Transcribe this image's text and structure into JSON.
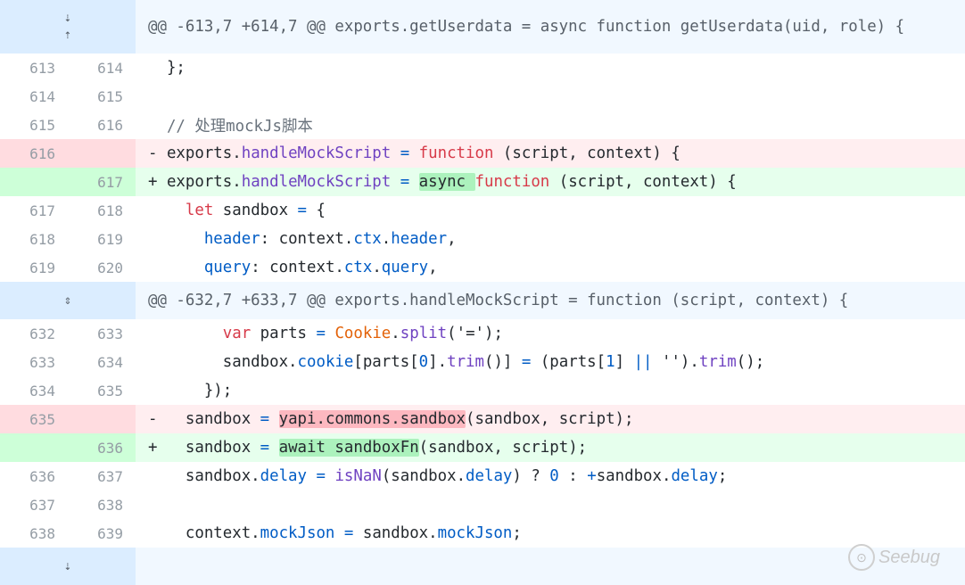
{
  "hunks": {
    "h1": "@@ -613,7 +614,7 @@ exports.getUserdata = async function getUserdata(uid, role) {",
    "h2": "@@ -632,7 +633,7 @@ exports.handleMockScript = function (script, context) {"
  },
  "lines": {
    "l1": {
      "old": "613",
      "new": "614"
    },
    "l2": {
      "old": "614",
      "new": "615"
    },
    "l3": {
      "old": "615",
      "new": "616"
    },
    "l4": {
      "old": "616",
      "new": ""
    },
    "l5": {
      "old": "",
      "new": "617"
    },
    "l6": {
      "old": "617",
      "new": "618"
    },
    "l7": {
      "old": "618",
      "new": "619"
    },
    "l8": {
      "old": "619",
      "new": "620"
    },
    "l9": {
      "old": "632",
      "new": "633"
    },
    "l10": {
      "old": "633",
      "new": "634"
    },
    "l11": {
      "old": "634",
      "new": "635"
    },
    "l12": {
      "old": "635",
      "new": ""
    },
    "l13": {
      "old": "",
      "new": "636"
    },
    "l14": {
      "old": "636",
      "new": "637"
    },
    "l15": {
      "old": "637",
      "new": "638"
    },
    "l16": {
      "old": "638",
      "new": "639"
    }
  },
  "code": {
    "l1": "  };",
    "l3": "  // 处理mockJs脚本",
    "l4_sign": "- ",
    "l4_obj": "exports.",
    "l4_prop": "handleMockScript",
    "l4_eq": " = ",
    "l4_kw": "function",
    "l4_rest": " (script, context) {",
    "l5_sign": "+ ",
    "l5_obj": "exports.",
    "l5_prop": "handleMockScript",
    "l5_eq": " = ",
    "l5_async": "async ",
    "l5_kw": "function",
    "l5_rest": " (script, context) {",
    "l6_indent": "    ",
    "l6_kw": "let",
    "l6_var": " sandbox ",
    "l6_eq": "=",
    "l6_rest": " {",
    "l7_indent": "      ",
    "l7_key": "header",
    "l7_mid": ": context.",
    "l7_p1": "ctx",
    "l7_dot": ".",
    "l7_p2": "header",
    "l7_end": ",",
    "l8_indent": "      ",
    "l8_key": "query",
    "l8_mid": ": context.",
    "l8_p1": "ctx",
    "l8_dot": ".",
    "l8_p2": "query",
    "l8_end": ",",
    "l9_indent": "        ",
    "l9_kw": "var",
    "l9_var": " parts ",
    "l9_eq": "=",
    "l9_sp": " ",
    "l9_cookie": "Cookie",
    "l9_dot": ".",
    "l9_split": "split",
    "l9_end": "('=');",
    "l10_indent": "        sandbox.",
    "l10_cookie": "cookie",
    "l10_a": "[parts[",
    "l10_zero": "0",
    "l10_b": "].",
    "l10_trim": "trim",
    "l10_c": "()] ",
    "l10_eq": "=",
    "l10_d": " (parts[",
    "l10_one": "1",
    "l10_e": "] ",
    "l10_or": "||",
    "l10_f": " '').",
    "l10_trim2": "trim",
    "l10_g": "();",
    "l11": "      });",
    "l12_pre": "-   sandbox ",
    "l12_eq": "=",
    "l12_sp": " ",
    "l12_hl": "yapi.commons.sandbox",
    "l12_rest": "(sandbox, script);",
    "l13_pre": "+   sandbox ",
    "l13_eq": "=",
    "l13_sp": " ",
    "l13_hl": "await sandboxFn",
    "l13_rest": "(sandbox, script);",
    "l14_pre": "    sandbox.",
    "l14_delay": "delay",
    "l14_sp": " ",
    "l14_eq": "=",
    "l14_sp2": " ",
    "l14_isnan": "isNaN",
    "l14_a": "(sandbox.",
    "l14_delay2": "delay",
    "l14_b": ") ? ",
    "l14_zero": "0",
    "l14_c": " : ",
    "l14_plus": "+",
    "l14_d": "sandbox.",
    "l14_delay3": "delay",
    "l14_e": ";",
    "l16_pre": "    context.",
    "l16_mock": "mockJson",
    "l16_sp": " ",
    "l16_eq": "=",
    "l16_mid": " sandbox.",
    "l16_mock2": "mockJson",
    "l16_end": ";"
  },
  "icons": {
    "expand_down": "expand-down-icon",
    "expand_up": "expand-up-icon",
    "expand_both": "expand-both-icon"
  },
  "watermark": {
    "text": "Seebug"
  },
  "colors": {
    "hunk_bg": "#f1f8ff",
    "hunk_gutter": "#dbedff",
    "del_bg": "#ffeef0",
    "add_bg": "#e6ffed",
    "keyword": "#d73a49",
    "function": "#6f42c1",
    "property": "#005cc5"
  }
}
